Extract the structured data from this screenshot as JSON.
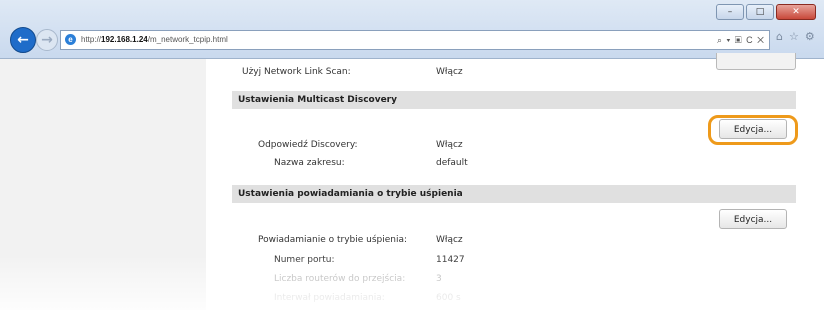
{
  "browser": {
    "url_prefix": "http://",
    "url_host": "192.168.1.24",
    "url_path": "/m_network_tcpip.html",
    "address_tools": "⌕ ▾ ▣ C ✕",
    "window_buttons": [
      "–",
      "□",
      "✕"
    ]
  },
  "top_row": {
    "label": "Użyj Network Link Scan:",
    "value": "Włącz"
  },
  "multicast": {
    "header": "Ustawienia Multicast Discovery",
    "edit_label": "Edycja...",
    "rows": [
      {
        "label": "Odpowiedź Discovery:",
        "value": "Włącz"
      },
      {
        "label": "Nazwa zakresu:",
        "value": "default"
      }
    ]
  },
  "sleep": {
    "header": "Ustawienia powiadamiania o trybie uśpienia",
    "edit_label": "Edycja...",
    "rows": [
      {
        "label": "Powiadamianie o trybie uśpienia:",
        "value": "Włącz"
      },
      {
        "label": "Numer portu:",
        "value": "11427"
      },
      {
        "label": "Liczba routerów do przejścia:",
        "value": "3"
      },
      {
        "label": "Interwał powiadamiania:",
        "value": "600 s"
      }
    ]
  },
  "icons": [
    "back-arrow-icon",
    "forward-arrow-icon",
    "ie-logo-icon",
    "home-icon",
    "star-icon",
    "gear-icon"
  ],
  "colors": {
    "highlight": "#ee9a1b",
    "back_button": "#1f6cc9"
  }
}
